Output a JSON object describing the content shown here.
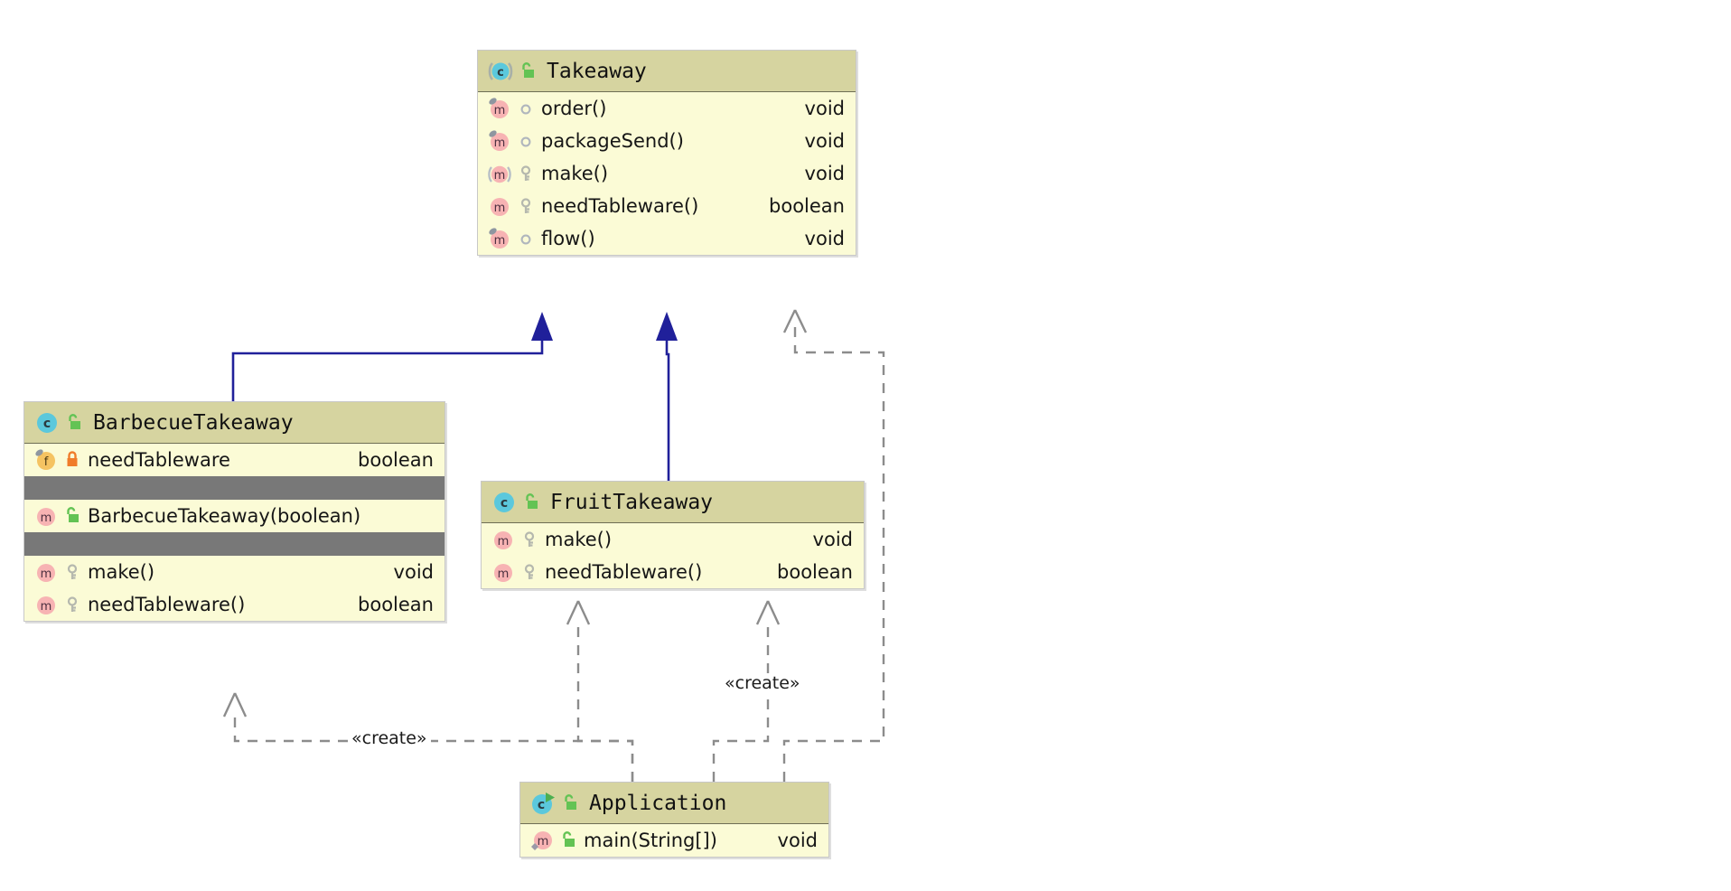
{
  "diagram": {
    "type": "uml-class-diagram",
    "background": "#ffffff",
    "colors": {
      "class_header": "#d6d4a0",
      "class_body": "#fbfbd6",
      "class_border": "#c8c8c8",
      "separator_row": "#787878",
      "inheritance_line": "#20209a",
      "dependency_line": "#8c8c8c",
      "class_icon": "#5bc8dc",
      "method_icon": "#f7b3b3",
      "field_icon": "#f5c362",
      "public_lock": "#63c354",
      "private_lock": "#f07c2a",
      "protected_key": "#b5b8ae",
      "run_arrow": "#4caf50",
      "static_diamond": "#9a9aa8"
    }
  },
  "classes": [
    {
      "id": "takeaway",
      "name": "Takeaway",
      "class_icon": "abstract-class-icon",
      "visibility_icon": "public-unlock-icon",
      "sections": [
        {
          "kind": "members",
          "members": [
            {
              "icon": "method-icon",
              "modifier": "final-method-marker",
              "visibility": "public-circle-icon",
              "name": "order()",
              "type": "void"
            },
            {
              "icon": "method-icon",
              "modifier": "final-method-marker",
              "visibility": "public-circle-icon",
              "name": "packageSend()",
              "type": "void"
            },
            {
              "icon": "abstract-method-icon",
              "modifier": "",
              "visibility": "protected-key-icon",
              "name": "make()",
              "type": "void"
            },
            {
              "icon": "method-icon",
              "modifier": "",
              "visibility": "protected-key-icon",
              "name": "needTableware()",
              "type": "boolean"
            },
            {
              "icon": "method-icon",
              "modifier": "final-method-marker",
              "visibility": "public-circle-icon",
              "name": "flow()",
              "type": "void"
            }
          ]
        }
      ]
    },
    {
      "id": "barbecue",
      "name": "BarbecueTakeaway",
      "class_icon": "class-icon",
      "visibility_icon": "public-unlock-icon",
      "sections": [
        {
          "kind": "members",
          "members": [
            {
              "icon": "field-icon",
              "modifier": "final-field-marker",
              "visibility": "private-lock-icon",
              "name": "needTableware",
              "type": "boolean"
            }
          ]
        },
        {
          "kind": "separator"
        },
        {
          "kind": "members",
          "members": [
            {
              "icon": "method-icon",
              "modifier": "",
              "visibility": "public-unlock-icon",
              "name": "BarbecueTakeaway(boolean)",
              "type": ""
            }
          ]
        },
        {
          "kind": "separator"
        },
        {
          "kind": "members",
          "members": [
            {
              "icon": "method-icon",
              "modifier": "",
              "visibility": "protected-key-icon",
              "name": "make()",
              "type": "void"
            },
            {
              "icon": "method-icon",
              "modifier": "",
              "visibility": "protected-key-icon",
              "name": "needTableware()",
              "type": "boolean"
            }
          ]
        }
      ]
    },
    {
      "id": "fruit",
      "name": "FruitTakeaway",
      "class_icon": "class-icon",
      "visibility_icon": "public-unlock-icon",
      "sections": [
        {
          "kind": "members",
          "members": [
            {
              "icon": "method-icon",
              "modifier": "",
              "visibility": "protected-key-icon",
              "name": "make()",
              "type": "void"
            },
            {
              "icon": "method-icon",
              "modifier": "",
              "visibility": "protected-key-icon",
              "name": "needTableware()",
              "type": "boolean"
            }
          ]
        }
      ]
    },
    {
      "id": "application",
      "name": "Application",
      "class_icon": "runnable-class-icon",
      "visibility_icon": "public-unlock-icon",
      "sections": [
        {
          "kind": "members",
          "members": [
            {
              "icon": "static-method-icon",
              "modifier": "static-diamond-marker",
              "visibility": "public-unlock-icon",
              "name": "main(String[])",
              "type": "void"
            }
          ]
        }
      ]
    }
  ],
  "edges": [
    {
      "id": "barbecue-extends-takeaway",
      "kind": "generalization",
      "from": "BarbecueTakeaway",
      "to": "Takeaway",
      "label": ""
    },
    {
      "id": "fruit-extends-takeaway",
      "kind": "generalization",
      "from": "FruitTakeaway",
      "to": "Takeaway",
      "label": ""
    },
    {
      "id": "application-creates-takeaway",
      "kind": "dependency",
      "from": "Application",
      "to": "Takeaway",
      "label": ""
    },
    {
      "id": "application-creates-barbecue",
      "kind": "dependency",
      "from": "Application",
      "to": "BarbecueTakeaway",
      "label": "«create»"
    },
    {
      "id": "application-creates-fruit-make",
      "kind": "dependency",
      "from": "Application",
      "to": "FruitTakeaway",
      "label": ""
    },
    {
      "id": "application-creates-fruit",
      "kind": "dependency",
      "from": "Application",
      "to": "FruitTakeaway",
      "label": "«create»"
    }
  ],
  "labels": {
    "create_left": "«create»",
    "create_right": "«create»"
  }
}
